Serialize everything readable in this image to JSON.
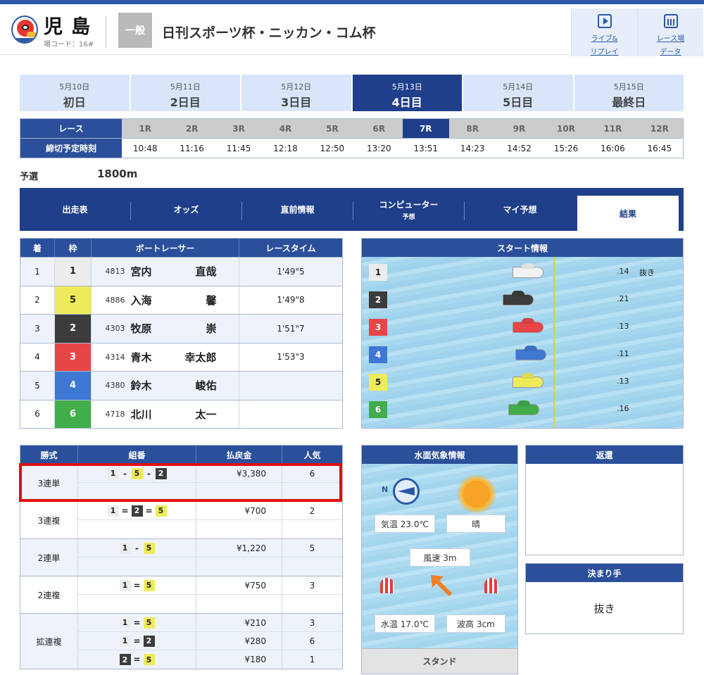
{
  "header": {
    "venue_name": "児島",
    "venue_code": "場コード：16#",
    "grade": "一般",
    "race_title": "日刊スポーツ杯・ニッカン・コム杯",
    "buttons": [
      {
        "label": "ライブ&\nリプレイ",
        "icon": "tv-icon"
      },
      {
        "label": "レース場\nデータ",
        "icon": "data-icon"
      }
    ]
  },
  "days": [
    {
      "date": "5月10日",
      "label": "初日"
    },
    {
      "date": "5月11日",
      "label": "2日目"
    },
    {
      "date": "5月12日",
      "label": "3日目"
    },
    {
      "date": "5月13日",
      "label": "4日目",
      "active": true
    },
    {
      "date": "5月14日",
      "label": "5日目"
    },
    {
      "date": "5月15日",
      "label": "最終日"
    }
  ],
  "race_table": {
    "race_header": "レース",
    "time_header": "締切予定時刻",
    "races": [
      "1R",
      "2R",
      "3R",
      "4R",
      "5R",
      "6R",
      "7R",
      "8R",
      "9R",
      "10R",
      "11R",
      "12R"
    ],
    "active_race": "7R",
    "times": [
      "10:48",
      "11:16",
      "11:45",
      "12:18",
      "12:50",
      "13:20",
      "13:51",
      "14:23",
      "14:52",
      "15:26",
      "16:06",
      "16:45"
    ]
  },
  "race_info": {
    "kind": "予選",
    "distance": "1800m"
  },
  "tabs": [
    {
      "label": "出走表"
    },
    {
      "label": "オッズ"
    },
    {
      "label": "直前情報"
    },
    {
      "label": "コンピューター",
      "sub": "予想"
    },
    {
      "label": "マイ予想"
    },
    {
      "label": "結果",
      "active": true
    }
  ],
  "results": {
    "headers": {
      "rank": "着",
      "frame": "枠",
      "racer": "ボートレーサー",
      "time": "レースタイム"
    },
    "rows": [
      {
        "rank": "1",
        "frame": "1",
        "reg_no": "4813",
        "last": "宮内",
        "first": "直哉",
        "time": "1'49\"5"
      },
      {
        "rank": "2",
        "frame": "5",
        "reg_no": "4886",
        "last": "入海",
        "first": "馨",
        "time": "1'49\"8"
      },
      {
        "rank": "3",
        "frame": "2",
        "reg_no": "4303",
        "last": "牧原",
        "first": "崇",
        "time": "1'51\"7"
      },
      {
        "rank": "4",
        "frame": "3",
        "reg_no": "4314",
        "last": "青木",
        "first": "幸太郎",
        "time": "1'53\"3"
      },
      {
        "rank": "5",
        "frame": "4",
        "reg_no": "4380",
        "last": "鈴木",
        "first": "峻佑",
        "time": ""
      },
      {
        "rank": "6",
        "frame": "6",
        "reg_no": "4718",
        "last": "北川",
        "first": "太一",
        "time": ""
      }
    ]
  },
  "start_info": {
    "title": "スタート情報",
    "lanes": [
      {
        "lane": "1",
        "st": ".14",
        "tech": "抜き",
        "boat_color": "#f2f2f2"
      },
      {
        "lane": "2",
        "st": ".21",
        "tech": "",
        "boat_color": "#3c3c3c"
      },
      {
        "lane": "3",
        "st": ".13",
        "tech": "",
        "boat_color": "#e74646"
      },
      {
        "lane": "4",
        "st": ".11",
        "tech": "",
        "boat_color": "#3e78d2"
      },
      {
        "lane": "5",
        "st": ".13",
        "tech": "",
        "boat_color": "#eeeb5b"
      },
      {
        "lane": "6",
        "st": ".16",
        "tech": "",
        "boat_color": "#41ad4b"
      }
    ]
  },
  "payouts": {
    "headers": {
      "kind": "勝式",
      "combo": "組番",
      "amount": "払戻金",
      "pop": "人気"
    },
    "groups": [
      {
        "kind": "3連単",
        "lines": [
          {
            "combo": [
              "1",
              "-",
              "5",
              "-",
              "2"
            ],
            "amount": "¥3,380",
            "pop": "6"
          },
          {
            "combo": [],
            "amount": "",
            "pop": ""
          }
        ]
      },
      {
        "kind": "3連複",
        "lines": [
          {
            "combo": [
              "1",
              "=",
              "2",
              "=",
              "5"
            ],
            "amount": "¥700",
            "pop": "2"
          },
          {
            "combo": [],
            "amount": "",
            "pop": ""
          }
        ]
      },
      {
        "kind": "2連単",
        "lines": [
          {
            "combo": [
              "1",
              "-",
              "5"
            ],
            "amount": "¥1,220",
            "pop": "5"
          },
          {
            "combo": [],
            "amount": "",
            "pop": ""
          }
        ]
      },
      {
        "kind": "2連複",
        "lines": [
          {
            "combo": [
              "1",
              "=",
              "5"
            ],
            "amount": "¥750",
            "pop": "3"
          },
          {
            "combo": [],
            "amount": "",
            "pop": ""
          }
        ]
      },
      {
        "kind": "拡連複",
        "lines": [
          {
            "combo": [
              "1",
              "=",
              "5"
            ],
            "amount": "¥210",
            "pop": "3"
          },
          {
            "combo": [
              "1",
              "=",
              "2"
            ],
            "amount": "¥280",
            "pop": "6"
          },
          {
            "combo": [
              "2",
              "=",
              "5"
            ],
            "amount": "¥180",
            "pop": "1"
          }
        ]
      }
    ]
  },
  "weather": {
    "title": "水面気象情報",
    "compass_label": "N",
    "temperature": "気温 23.0℃",
    "condition": "晴",
    "wind_speed": "風速 3m",
    "water_temp": "水温 17.0℃",
    "wave_height": "波高 3cm",
    "stand_label": "スタンド"
  },
  "refund": {
    "title": "返還"
  },
  "kimarite": {
    "title": "決まり手",
    "value": "抜き"
  },
  "colors": {
    "primary": "#2b4f9a",
    "active": "#1f3f8a",
    "highlight": "#e01010"
  }
}
